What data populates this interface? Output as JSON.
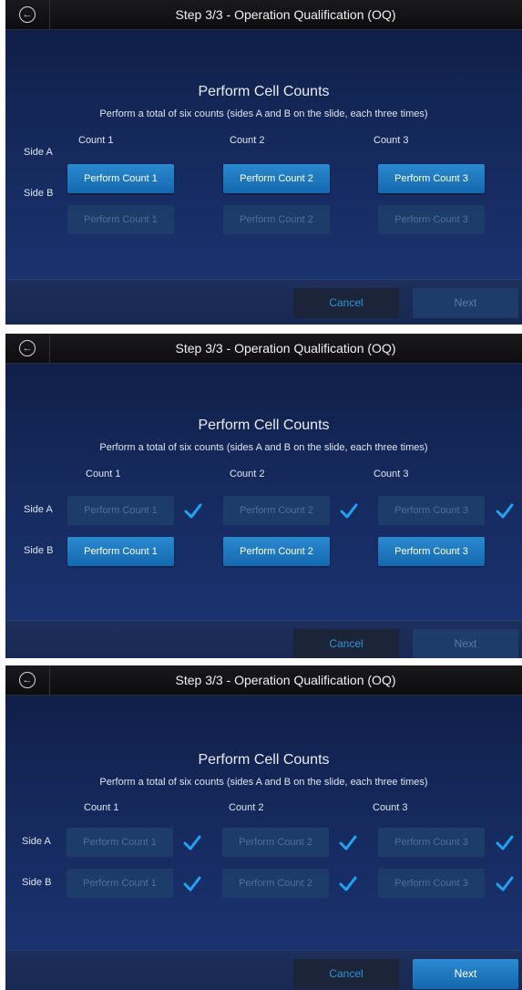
{
  "title": "Step 3/3 - Operation Qualification (OQ)",
  "heading": "Perform Cell Counts",
  "subheading": "Perform a total of six counts (sides A and B on the slide, each three times)",
  "columns": [
    "Count 1",
    "Count 2",
    "Count 3"
  ],
  "rows": [
    "Side A",
    "Side B"
  ],
  "buttons": [
    "Perform Count 1",
    "Perform Count 2",
    "Perform Count 3"
  ],
  "cancel_label": "Cancel",
  "next_label": "Next",
  "colors": {
    "accent": "#1f7cc4",
    "check": "#1fa3f5",
    "cancel_text": "#2f93d8"
  },
  "icons": {
    "back": "back-arrow-circle-icon",
    "done": "checkmark-icon"
  },
  "screens": [
    {
      "side_a": {
        "enabled": true,
        "done": false
      },
      "side_b": {
        "enabled": false,
        "done": false
      },
      "next_enabled": false
    },
    {
      "side_a": {
        "enabled": false,
        "done": true
      },
      "side_b": {
        "enabled": true,
        "done": false
      },
      "next_enabled": false
    },
    {
      "side_a": {
        "enabled": false,
        "done": true
      },
      "side_b": {
        "enabled": false,
        "done": true
      },
      "next_enabled": true
    }
  ]
}
